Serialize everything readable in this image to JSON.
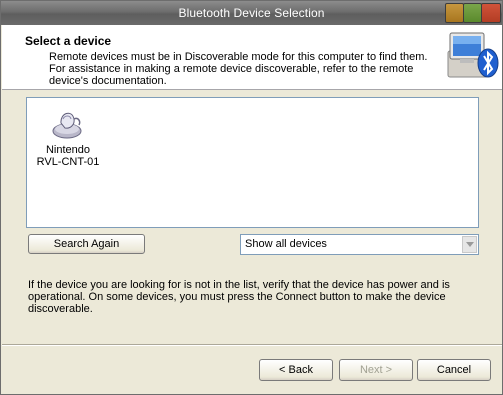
{
  "window": {
    "title": "Bluetooth Device Selection"
  },
  "header": {
    "heading": "Select a device",
    "description_lines": [
      "Remote devices must be in Discoverable mode for this computer to find them.",
      "For assistance in making a remote device discoverable, refer to the remote",
      "device's documentation."
    ],
    "icon": "bluetooth-computer-icon"
  },
  "devices": [
    {
      "name_line1": "Nintendo",
      "name_line2": "RVL-CNT-01",
      "icon": "mouse-device-icon"
    }
  ],
  "controls": {
    "search_again_label": "Search Again",
    "filter_selected": "Show all devices"
  },
  "info_lines": [
    "If the device you are looking for is not in the list, verify that the device has power and is",
    "operational. On some devices, you must press the Connect button to make the device",
    "discoverable."
  ],
  "footer": {
    "back_label": "< Back",
    "next_label": "Next >",
    "cancel_label": "Cancel"
  },
  "colors": {
    "dialog_bg": "#ece9d8",
    "list_border": "#7f9db9",
    "bluetooth_blue": "#1f5fcf",
    "disabled_text": "#a1a192"
  }
}
